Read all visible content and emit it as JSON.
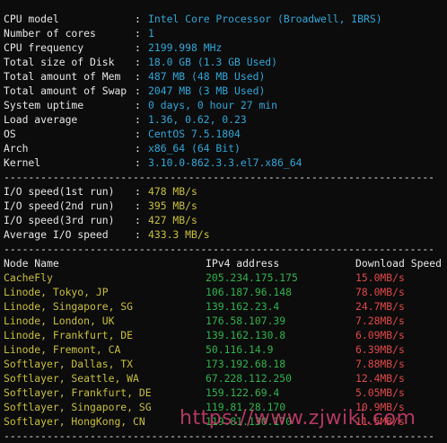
{
  "colors": {
    "background": "#0c0c0c",
    "text": "#e6e6e6",
    "cyan": "#2fa6d8",
    "yellow": "#c9bf3a",
    "green": "#2fb24b",
    "red": "#e04848",
    "watermark": "#e0457a"
  },
  "sysinfo": [
    {
      "label": "CPU model",
      "value": "Intel Core Processor (Broadwell, IBRS)"
    },
    {
      "label": "Number of cores",
      "value": "1"
    },
    {
      "label": "CPU frequency",
      "value": "2199.998 MHz"
    },
    {
      "label": "Total size of Disk",
      "value": "18.0 GB (1.3 GB Used)"
    },
    {
      "label": "Total amount of Mem",
      "value": "487 MB (48 MB Used)"
    },
    {
      "label": "Total amount of Swap",
      "value": "2047 MB (3 MB Used)"
    },
    {
      "label": "System uptime",
      "value": "0 days, 0 hour 27 min"
    },
    {
      "label": "Load average",
      "value": "1.36, 0.62, 0.23"
    },
    {
      "label": "OS",
      "value": "CentOS 7.5.1804"
    },
    {
      "label": "Arch",
      "value": "x86_64 (64 Bit)"
    },
    {
      "label": "Kernel",
      "value": "3.10.0-862.3.3.el7.x86_64"
    }
  ],
  "separator": "----------------------------------------------------------------------",
  "colon": ":",
  "io": [
    {
      "label": "I/O speed(1st run)",
      "value": "478 MB/s"
    },
    {
      "label": "I/O speed(2nd run)",
      "value": "395 MB/s"
    },
    {
      "label": "I/O speed(3rd run)",
      "value": "427 MB/s"
    },
    {
      "label": "Average I/O speed",
      "value": "433.3 MB/s"
    }
  ],
  "network": {
    "headers": {
      "name": "Node Name",
      "ip": "IPv4 address",
      "speed": "Download Speed"
    },
    "rows": [
      {
        "name": "CacheFly",
        "ip": "205.234.175.175",
        "speed": "15.0MB/s"
      },
      {
        "name": "Linode, Tokyo, JP",
        "ip": "106.187.96.148",
        "speed": "78.0MB/s"
      },
      {
        "name": "Linode, Singapore, SG",
        "ip": "139.162.23.4",
        "speed": "24.7MB/s"
      },
      {
        "name": "Linode, London, UK",
        "ip": "176.58.107.39",
        "speed": "7.28MB/s"
      },
      {
        "name": "Linode, Frankfurt, DE",
        "ip": "139.162.130.8",
        "speed": "6.09MB/s"
      },
      {
        "name": "Linode, Fremont, CA",
        "ip": "50.116.14.9",
        "speed": "6.39MB/s"
      },
      {
        "name": "Softlayer, Dallas, TX",
        "ip": "173.192.68.18",
        "speed": "7.88MB/s"
      },
      {
        "name": "Softlayer, Seattle, WA",
        "ip": "67.228.112.250",
        "speed": "12.4MB/s"
      },
      {
        "name": "Softlayer, Frankfurt, DE",
        "ip": "159.122.69.4",
        "speed": "5.05MB/s"
      },
      {
        "name": "Softlayer, Singapore, SG",
        "ip": "119.81.28.170",
        "speed": "10.9MB/s"
      },
      {
        "name": "Softlayer, HongKong, CN",
        "ip": "119.81.130.170",
        "speed": "11.5MB/s"
      }
    ]
  },
  "watermark": "https://www.zjwiki.com"
}
